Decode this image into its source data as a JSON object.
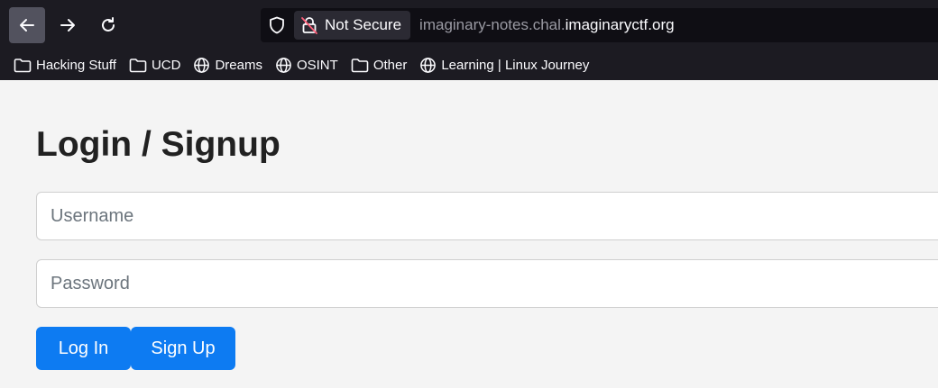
{
  "browser": {
    "security_label": "Not Secure",
    "url_prefix": "imaginary-notes.chal.",
    "url_domain": "imaginaryctf.org",
    "bookmarks": [
      {
        "label": "Hacking Stuff",
        "icon": "folder-icon"
      },
      {
        "label": "UCD",
        "icon": "folder-icon"
      },
      {
        "label": "Dreams",
        "icon": "globe-icon"
      },
      {
        "label": "OSINT",
        "icon": "globe-icon"
      },
      {
        "label": "Other",
        "icon": "folder-icon"
      },
      {
        "label": "Learning | Linux Journey",
        "icon": "globe-icon"
      }
    ]
  },
  "page": {
    "title": "Login / Signup",
    "username_placeholder": "Username",
    "password_placeholder": "Password",
    "login_label": "Log In",
    "signup_label": "Sign Up"
  },
  "colors": {
    "chrome_bg": "#1c1b22",
    "page_bg": "#f4f4f4",
    "button_bg": "#0d7bf2"
  }
}
